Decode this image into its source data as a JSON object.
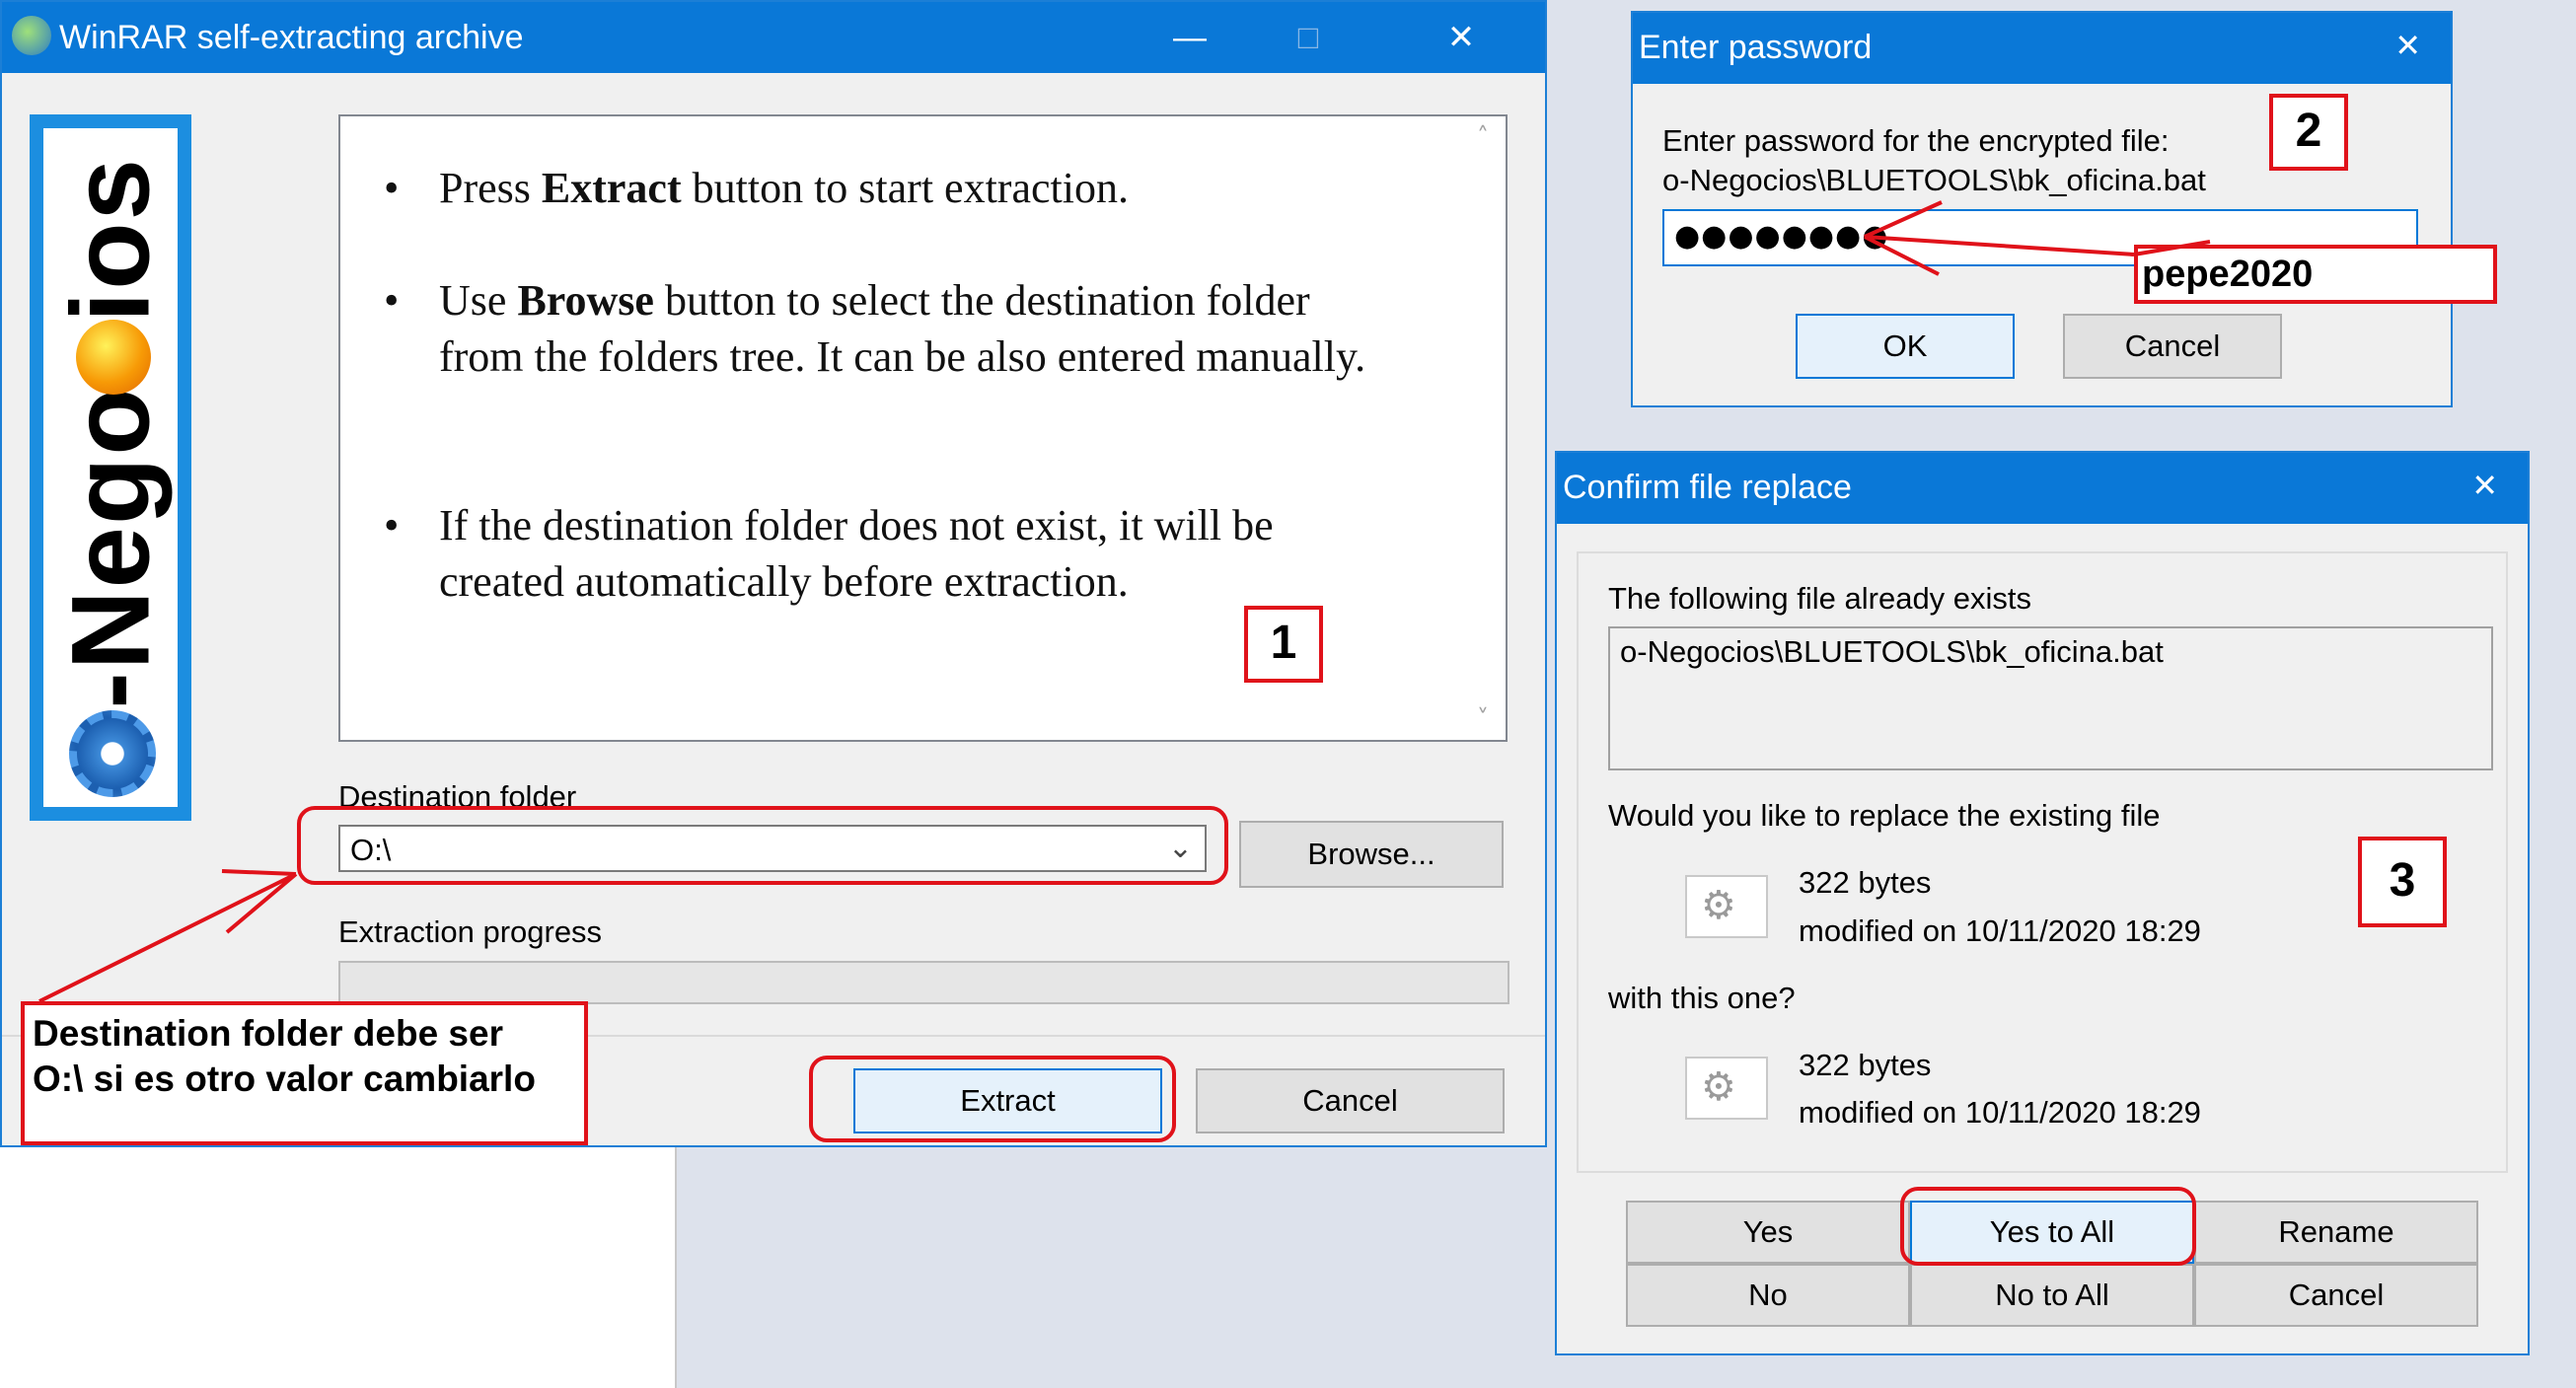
{
  "winrar": {
    "title": "WinRAR self-extracting archive",
    "logo_text": "o-Negocios",
    "instructions": [
      {
        "pre": "Press ",
        "bold": "Extract",
        "post": " button to start extraction."
      },
      {
        "pre": "Use ",
        "bold": "Browse",
        "post": " button to select the destination folder from the folders tree. It can be also entered manually."
      },
      {
        "pre": "",
        "bold": "",
        "post": "If the destination folder does not exist, it will be created automatically before extraction."
      }
    ],
    "destination_label": "Destination folder",
    "destination_value": "O:\\",
    "browse_label": "Browse...",
    "progress_label": "Extraction progress",
    "progress": 0,
    "extract_label": "Extract",
    "cancel_label": "Cancel"
  },
  "password_dialog": {
    "title": "Enter password",
    "prompt_line1": "Enter password for the encrypted file:",
    "prompt_line2": "o-Negocios\\BLUETOOLS\\bk_oficina.bat",
    "masked_value": "●●●●●●●●",
    "ok_label": "OK",
    "cancel_label": "Cancel"
  },
  "replace_dialog": {
    "title": "Confirm file replace",
    "exists_label": "The following file already exists",
    "file_path": "o-Negocios\\BLUETOOLS\\bk_oficina.bat",
    "question": "Would you like to replace the existing file",
    "existing": {
      "size": "322 bytes",
      "modified": "modified on 10/11/2020 18:29"
    },
    "with_label": "with this one?",
    "new": {
      "size": "322 bytes",
      "modified": "modified on 10/11/2020 18:29"
    },
    "buttons": {
      "yes": "Yes",
      "yes_all": "Yes to All",
      "rename": "Rename",
      "no": "No",
      "no_all": "No to All",
      "cancel": "Cancel"
    }
  },
  "annotations": {
    "num1": "1",
    "num2": "2",
    "num3": "3",
    "password_hint": "pepe2020",
    "dest_note_line1": "Destination folder debe ser",
    "dest_note_line2": "O:\\  si es otro valor cambiarlo"
  },
  "colors": {
    "title_blue": "#0a78d7",
    "annotation_red": "#e0121a",
    "logo_blue": "#1c8ee0",
    "desktop": "#dde2ec"
  }
}
